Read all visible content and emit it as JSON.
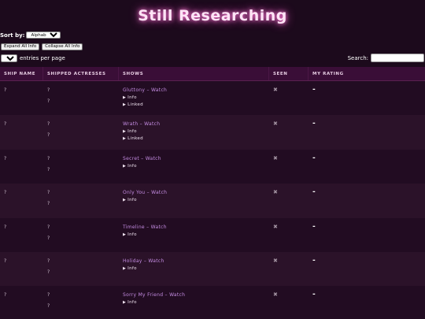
{
  "page": {
    "title": "Still Researching"
  },
  "controls": {
    "sort_label": "Sort by:",
    "sort_value": "Alphabetical",
    "expand_label": "Expand All Info",
    "collapse_label": "Collapse All Info",
    "entries_value": "50",
    "entries_label": "entries per page",
    "search_label": "Search:",
    "search_value": ""
  },
  "table": {
    "headers": [
      "SHIP NAME",
      "SHIPPED ACTRESSES",
      "SHOWS",
      "SEEN",
      "MY RATING"
    ],
    "rows": [
      {
        "ship": "?",
        "actress1": "?",
        "actress2": "?",
        "show": "Gluttony – Watch",
        "details": [
          "Info",
          "Linked"
        ],
        "seen": "✖",
        "rating": "-"
      },
      {
        "ship": "?",
        "actress1": "?",
        "actress2": "?",
        "show": "Wrath – Watch",
        "details": [
          "Info",
          "Linked"
        ],
        "seen": "✖",
        "rating": "-"
      },
      {
        "ship": "?",
        "actress1": "?",
        "actress2": "?",
        "show": "Secret – Watch",
        "details": [
          "Info"
        ],
        "seen": "✖",
        "rating": "-"
      },
      {
        "ship": "?",
        "actress1": "?",
        "actress2": "?",
        "show": "Only You – Watch",
        "details": [
          "Info"
        ],
        "seen": "✖",
        "rating": "-"
      },
      {
        "ship": "?",
        "actress1": "?",
        "actress2": "?",
        "show": "Timeline – Watch",
        "details": [
          "Info"
        ],
        "seen": "✖",
        "rating": "-"
      },
      {
        "ship": "?",
        "actress1": "?",
        "actress2": "?",
        "show": "Holiday – Watch",
        "details": [
          "Info"
        ],
        "seen": "✖",
        "rating": "-"
      },
      {
        "ship": "?",
        "actress1": "?",
        "actress2": "?",
        "show": "Sorry My Friend – Watch",
        "details": [
          "Info"
        ],
        "seen": "✖",
        "rating": "-"
      }
    ]
  }
}
